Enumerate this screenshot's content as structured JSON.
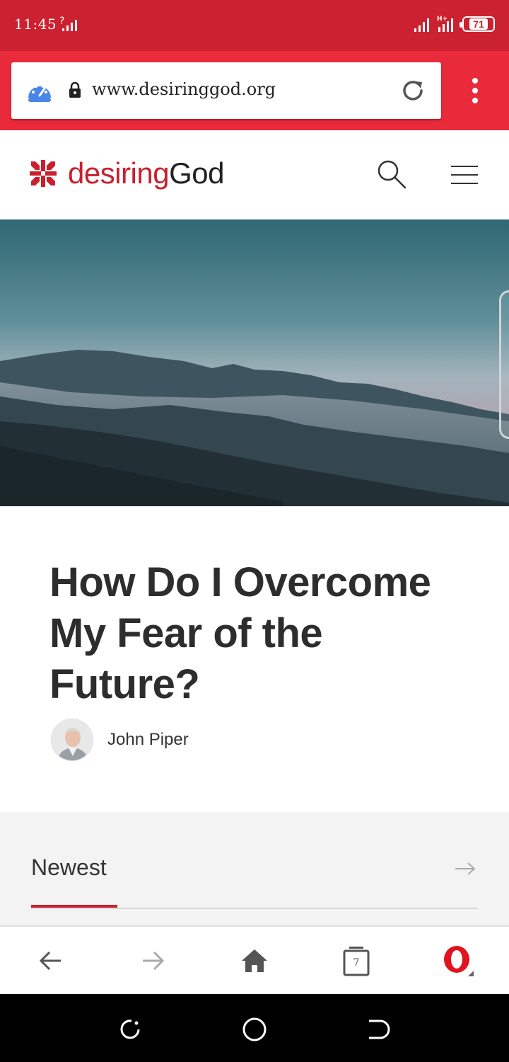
{
  "status": {
    "time": "11:45",
    "battery": "71"
  },
  "browser": {
    "url": "www.desiringgod.org"
  },
  "site": {
    "logo_part1": "desiring",
    "logo_part2": "God"
  },
  "article": {
    "title": "How Do I Overcome My Fear of the Future?",
    "author": "John Piper"
  },
  "section": {
    "label": "Newest"
  },
  "navbar": {
    "tab_count": "7"
  },
  "colors": {
    "brand_red": "#c8202e",
    "statusbar": "#cc2130",
    "browserbar": "#e92a3b",
    "opera_red": "#e0131f"
  }
}
